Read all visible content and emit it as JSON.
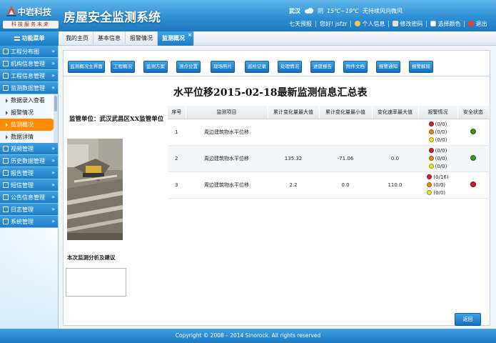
{
  "brand": {
    "company_name": "中岩科技",
    "slogan": "科技服务未来",
    "app_title": "房屋安全监测系统"
  },
  "weather": {
    "city": "武汉",
    "condition": "阴",
    "temperature": "15℃~19℃",
    "wind": "无持续风向微风"
  },
  "userbar": {
    "forecast_link": "七天预报",
    "greeting": "您好! jsfzr",
    "personal_info": "个人信息",
    "change_password": "修改密码",
    "choose_color": "选择颜色",
    "logout": "退出"
  },
  "menu": {
    "title": "功能菜单",
    "items": [
      {
        "label": "工程分布图"
      },
      {
        "label": "机构信息管理"
      },
      {
        "label": "工程信息管理"
      },
      {
        "label": "监测数据管理"
      }
    ],
    "sub_items": [
      {
        "label": "数据录入查看"
      },
      {
        "label": "报警情况"
      },
      {
        "label": "监测概况"
      },
      {
        "label": "数据详情"
      }
    ],
    "bottom_items": [
      {
        "label": "视频管理"
      },
      {
        "label": "历史数据管理"
      },
      {
        "label": "报告管理"
      },
      {
        "label": "短信管理"
      },
      {
        "label": "公告信息管理"
      },
      {
        "label": "日志管理"
      },
      {
        "label": "系统管理"
      }
    ]
  },
  "tabs": [
    {
      "label": "我的主页"
    },
    {
      "label": "基本信息"
    },
    {
      "label": "报警情况"
    },
    {
      "label": "监测概况",
      "active": true
    }
  ],
  "toolbar": [
    {
      "label": "监测概况主界面"
    },
    {
      "label": "工程概况"
    },
    {
      "label": "监测方案"
    },
    {
      "label": "测点位置"
    },
    {
      "label": "现场照片"
    },
    {
      "label": "巡检记录"
    },
    {
      "label": "处理情况"
    },
    {
      "label": "进度报告"
    },
    {
      "label": "附件文档"
    },
    {
      "label": "报警通知"
    },
    {
      "label": "报警解除"
    }
  ],
  "left_panel": {
    "unit_label": "监管单位：武汉武昌区XX监管单位",
    "analysis_label": "本次监测分析及建议"
  },
  "summary": {
    "title": "水平位移2015-02-18最新监测信息汇总表",
    "columns": [
      "序号",
      "监测项目",
      "累计变化量最大值",
      "累计变化量最小值",
      "变化速率最大值",
      "报警情况",
      "安全状态"
    ],
    "rows": [
      {
        "no": "1",
        "item": "周边建筑物水平位移",
        "max": "",
        "min": "",
        "rate": "",
        "alarms": [
          "(0/0)",
          "(0/0)",
          "(0/0)"
        ],
        "status_color": "#3a9a1e"
      },
      {
        "no": "2",
        "item": "周边建筑物水平位移",
        "max": "135.32",
        "min": "-71.06",
        "rate": "0.0",
        "alarms": [
          "(0/0)",
          "(0/0)",
          "(0/0)"
        ],
        "status_color": "#3a9a1e"
      },
      {
        "no": "3",
        "item": "周边建筑物水平位移",
        "max": "2.2",
        "min": "0.0",
        "rate": "110.0",
        "alarms": [
          "(0/16)",
          "(0/0)",
          "(0/0)"
        ],
        "status_color": "#c8181e"
      }
    ],
    "alarm_colors": [
      "#d42020",
      "#e88a1a",
      "#f2e21a"
    ]
  },
  "back_button": "返回",
  "footer": "Copyright © 2008 – 2014 Sinorock. All rights reserved",
  "colors": {
    "header_blue": "#2e8fd3",
    "active_menu_orange": "#ff8a00",
    "button_blue": "#1570c0"
  }
}
